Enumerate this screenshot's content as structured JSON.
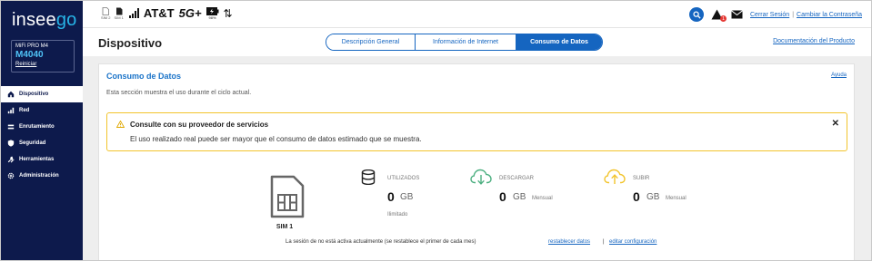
{
  "brand": {
    "logo_main": "insee",
    "logo_accent": "go"
  },
  "device": {
    "name": "MiFi PRO M4",
    "model": "M4040",
    "reboot_label": "Reiniciar"
  },
  "sidebar": {
    "items": [
      {
        "label": "Dispositivo",
        "icon": "home-icon",
        "active": true
      },
      {
        "label": "Red",
        "icon": "signal-bars-icon",
        "active": false
      },
      {
        "label": "Enrutamiento",
        "icon": "routing-icon",
        "active": false
      },
      {
        "label": "Seguridad",
        "icon": "shield-icon",
        "active": false
      },
      {
        "label": "Herramientas",
        "icon": "wrench-icon",
        "active": false
      },
      {
        "label": "Administración",
        "icon": "gear-icon",
        "active": false
      }
    ]
  },
  "statusbar": {
    "sim_left_label": "SIM 2",
    "sim_right_label": "SIM 1",
    "carrier": "AT&T",
    "network_type": "5G+",
    "battery_pct": "98%",
    "data_arrows": "⇅"
  },
  "topbar": {
    "alert_count": "1",
    "logout_label": "Cerrar Sesión",
    "separator": "|",
    "change_password_label": "Cambiar la Contraseña"
  },
  "page": {
    "title": "Dispositivo",
    "documentation_link": "Documentación del Producto"
  },
  "tabs": [
    {
      "label": "Descripción General",
      "active": false
    },
    {
      "label": "Información de Internet",
      "active": false
    },
    {
      "label": "Consumo de Datos",
      "active": true
    }
  ],
  "panel": {
    "title": "Consumo de Datos",
    "help_label": "Ayuda",
    "description": "Esta sección muestra el uso durante el ciclo actual."
  },
  "alert": {
    "title": "Consulte con su proveedor de servicios",
    "message": "El uso realizado real puede ser mayor que el consumo de datos estimado que se muestra.",
    "close_glyph": "✕"
  },
  "sim": {
    "label": "SIM 1"
  },
  "stats": {
    "used": {
      "label": "UTILIZADOS",
      "value": "0",
      "unit": "GB",
      "sub": "Ilimitado"
    },
    "download": {
      "label": "DESCARGAR",
      "value": "0",
      "unit": "GB",
      "period": "Mensual"
    },
    "upload": {
      "label": "SUBIR",
      "value": "0",
      "unit": "GB",
      "period": "Mensual"
    }
  },
  "footer": {
    "session_text": "La sesión de  no está activa actualmente (se restablece el primer de cada mes)",
    "reset_link": "restablecer datos",
    "separator": "|",
    "edit_link": "editar configuración"
  },
  "colors": {
    "sidebar_bg": "#0d1a4c",
    "accent_blue": "#1565c0",
    "alert_border": "#f2c42c",
    "download_green": "#4caf80",
    "upload_yellow": "#f2c42c"
  }
}
